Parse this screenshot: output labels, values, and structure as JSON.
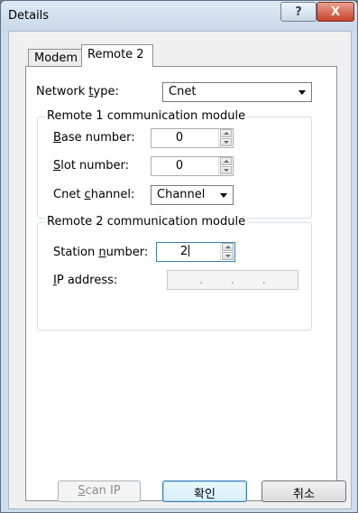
{
  "window": {
    "title": "Details",
    "help_glyph": "?",
    "close_glyph": "X"
  },
  "tabs": [
    {
      "label": "Modem",
      "selected": false
    },
    {
      "label": "Remote 2",
      "selected": true
    }
  ],
  "network_type": {
    "label_pre": "Network ",
    "label_mnemonic": "t",
    "label_post": "ype:",
    "value": "Cnet"
  },
  "remote1": {
    "title": "Remote 1 communication module",
    "base": {
      "label_mnemonic": "B",
      "label_post": "ase number:",
      "value": "0"
    },
    "slot": {
      "label_mnemonic": "S",
      "label_post": "lot number:",
      "value": "0"
    },
    "cnet_channel": {
      "label_pre": "Cnet ",
      "label_mnemonic": "c",
      "label_post": "hannel:",
      "value": "Channel"
    }
  },
  "remote2": {
    "title": "Remote 2 communication module",
    "station": {
      "label_pre": "Station ",
      "label_mnemonic": "n",
      "label_post": "umber:",
      "value": "2"
    },
    "ip": {
      "label_mnemonic": "I",
      "label_post": "P address:",
      "dots": [
        ".",
        ".",
        "."
      ]
    }
  },
  "buttons": {
    "scan_mnemonic": "S",
    "scan_post": "can IP",
    "ok": "확인",
    "cancel": "취소"
  }
}
